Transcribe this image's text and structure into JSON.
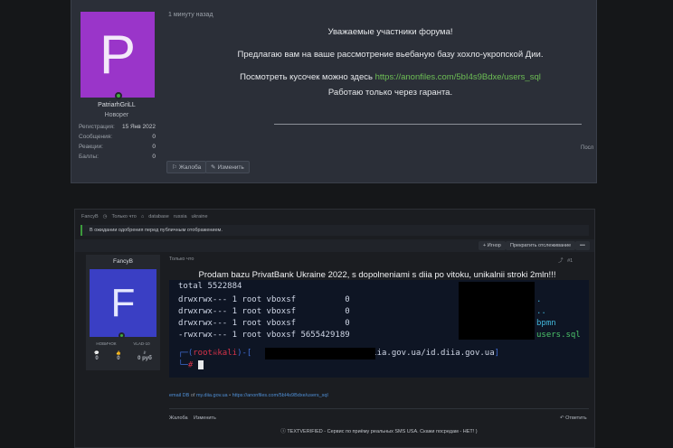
{
  "post1": {
    "avatar_letter": "P",
    "username": "PatriarhGriLL",
    "role": "Новорег",
    "stats": [
      {
        "label": "Регистрация:",
        "value": "15 Янв 2022"
      },
      {
        "label": "Сообщения:",
        "value": "0"
      },
      {
        "label": "Реакции:",
        "value": "0"
      },
      {
        "label": "Баллы:",
        "value": "0"
      }
    ],
    "timestamp": "1 минуту назад",
    "greeting": "Уважаемые участники форума!",
    "line1": "Предлагаю вам на ваше рассмотрение вьебаную базу хохло-укропской Дии.",
    "line2_prefix": "Посмотреть кусочек можно здесь",
    "line2_link": "https://anonfiles.com/5bI4s9Bdxe/users_sql",
    "line3": "Работаю только через гаранта.",
    "right_fragment": "Посл",
    "report_label": "Жалоба",
    "edit_label": "Изменить"
  },
  "post2": {
    "breadcrumb": [
      "FancyB",
      "Только что",
      "database",
      "russia",
      "ukraine"
    ],
    "notice": "В ожидании одобрения перед публичным отображением.",
    "ignore_label": "Игнор",
    "unwatch_label": "Прекратить отслеживание",
    "more_label": "•••",
    "username": "FancyB",
    "avatar_letter": "F",
    "tags": [
      "НОВИЧОК",
      "VLAD-10"
    ],
    "stats": [
      {
        "icon": "💬",
        "value": "0"
      },
      {
        "icon": "👍",
        "value": "0"
      },
      {
        "icon": "₽",
        "value": "0 руб"
      }
    ],
    "timestamp": "Только что",
    "post_number": "#1",
    "title": "Prodam bazu PrivatBank Ukraine 2022, s dopolneniami s diia po vitoku, unikalnii stroki 2mln!!!",
    "terminal": {
      "total": "total 5522884",
      "rows": [
        {
          "perm": "drwxrwx--- 1 root vboxsf",
          "size": "0",
          "name": "."
        },
        {
          "perm": "drwxrwx--- 1 root vboxsf",
          "size": "0",
          "name": ".."
        },
        {
          "perm": "drwxrwx--- 1 root vboxsf",
          "size": "0",
          "name": "bpmn"
        },
        {
          "perm": "-rwxrwx--- 1 root vboxsf",
          "size": "5655429189",
          "name": "users.sql"
        }
      ],
      "prompt_user": "root",
      "prompt_host": "kali",
      "prompt_path": "/diia.gov.ua/id.diia.gov.ua",
      "prompt_symbol": "#"
    },
    "source_prefix": "email DB",
    "source_of": "of",
    "source_site": "my.diia.gov.ua",
    "source_link": "https://anonfiles.com/5bI4s9Bdxe/users_sql",
    "report_label": "Жалоба",
    "edit_label": "Изменить",
    "reply_label": "Ответить",
    "ad_text": "TEXTVERIFIED - Сервис по приёму реальных SMS USA. Скажи посредам - НЕТ! )"
  }
}
